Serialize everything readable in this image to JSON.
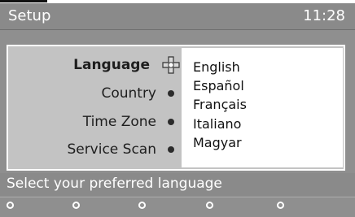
{
  "header": {
    "title": "Setup",
    "time": "11:28"
  },
  "menu": {
    "items": [
      {
        "label": "Language",
        "active": true,
        "icon": "navigation-cross-icon"
      },
      {
        "label": "Country",
        "active": false,
        "icon": "bullet-icon"
      },
      {
        "label": "Time Zone",
        "active": false,
        "icon": "bullet-icon"
      },
      {
        "label": "Service Scan",
        "active": false,
        "icon": "bullet-icon"
      }
    ]
  },
  "options": {
    "items": [
      "English",
      "Español",
      "Français",
      "Italiano",
      "Magyar"
    ]
  },
  "hint": {
    "text": "Select your preferred language"
  },
  "footer": {
    "buttons": [
      "circle-icon",
      "circle-icon",
      "circle-icon",
      "circle-icon",
      "circle-icon"
    ]
  },
  "colors": {
    "background": "#8f8f8f",
    "panel": "#c3c3c3",
    "list": "#ffffff",
    "text": "#1e1e1e"
  }
}
